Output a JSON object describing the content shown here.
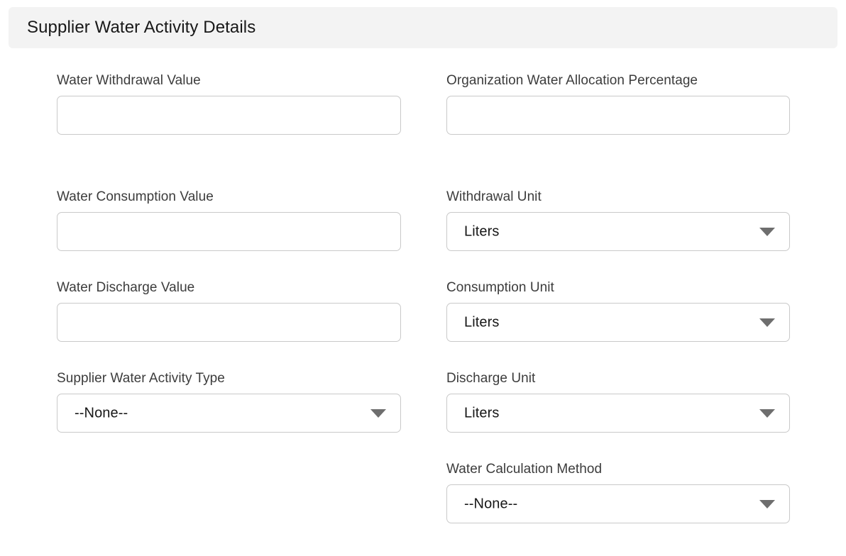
{
  "section": {
    "title": "Supplier Water Activity Details"
  },
  "icons": {
    "dropdown_arrow": "chevron-down-icon"
  },
  "colors": {
    "header_background": "#f3f3f3",
    "page_background": "#ffffff",
    "label_text": "#3c3c3c",
    "value_text": "#161616",
    "field_border": "#c9c9c9",
    "arrow": "#6e6e6e"
  },
  "left_column": {
    "fields": [
      {
        "label": "Water Withdrawal Value",
        "type": "text",
        "value": "",
        "placeholder": ""
      },
      {
        "label": "Water Consumption Value",
        "type": "text",
        "value": "",
        "placeholder": ""
      },
      {
        "label": "Water Discharge Value",
        "type": "text",
        "value": "",
        "placeholder": ""
      },
      {
        "label": "Supplier Water Activity Type",
        "type": "select",
        "value": "--None--"
      }
    ]
  },
  "right_column": {
    "fields": [
      {
        "label": "Organization Water Allocation Percentage",
        "type": "text",
        "value": "",
        "placeholder": ""
      },
      {
        "label": "Withdrawal Unit",
        "type": "select",
        "value": "Liters"
      },
      {
        "label": "Consumption Unit",
        "type": "select",
        "value": "Liters"
      },
      {
        "label": "Discharge Unit",
        "type": "select",
        "value": "Liters"
      },
      {
        "label": "Water Calculation Method",
        "type": "select",
        "value": "--None--"
      }
    ]
  }
}
